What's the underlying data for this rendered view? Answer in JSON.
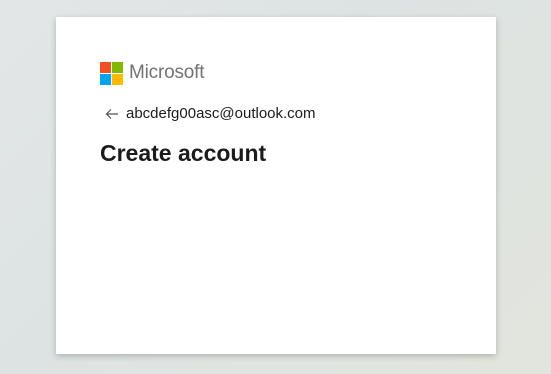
{
  "brand": {
    "name": "Microsoft",
    "logo_colors": [
      "#f25022",
      "#7fba00",
      "#00a4ef",
      "#ffb900"
    ]
  },
  "identity": {
    "back_icon": "arrow-left-icon",
    "email": "abcdefg00asc@outlook.com"
  },
  "page": {
    "title": "Create account"
  }
}
